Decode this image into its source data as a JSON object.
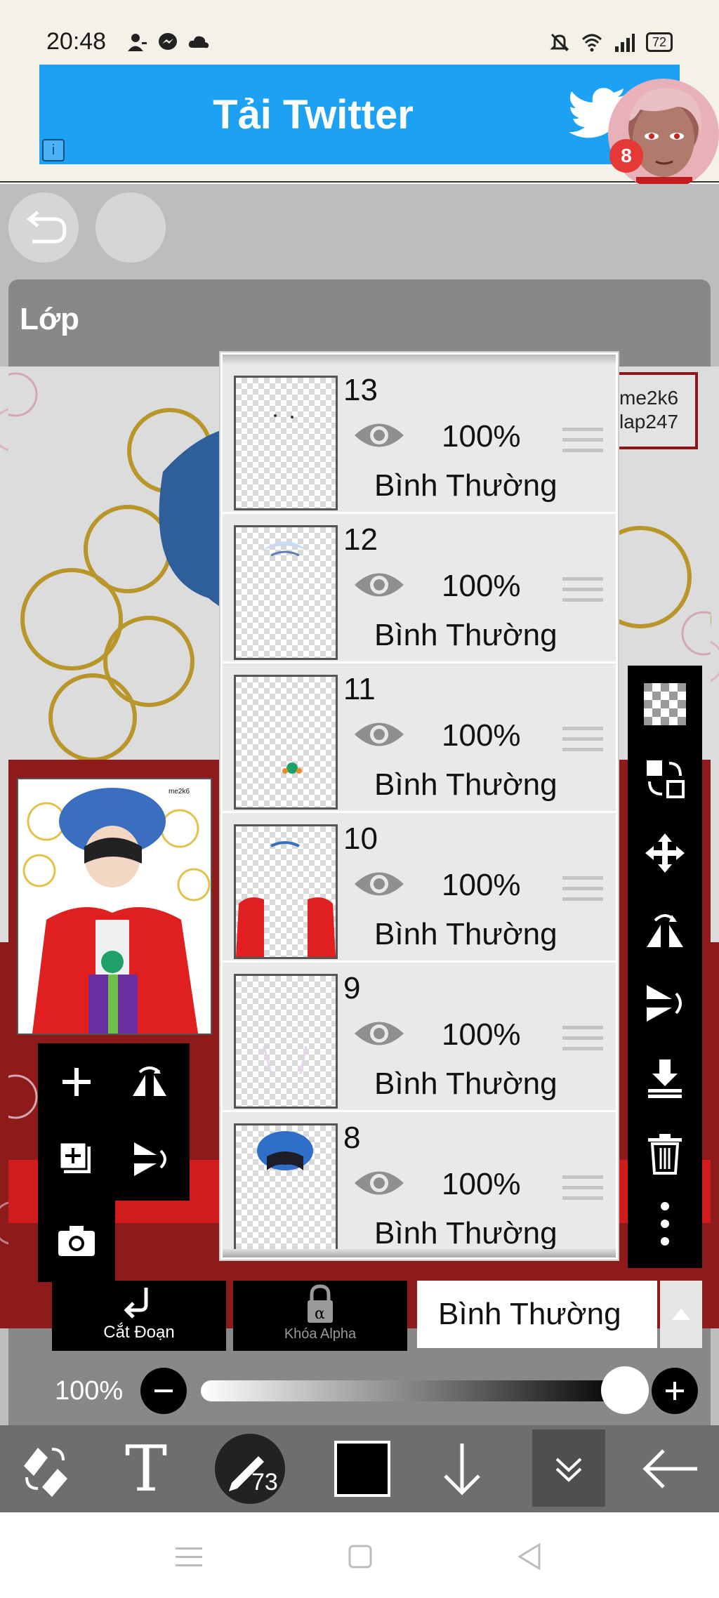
{
  "status_bar": {
    "time": "20:48",
    "battery": "72",
    "left_icons": [
      "person-icon",
      "messenger-icon",
      "cloud-icon"
    ],
    "right_icons": [
      "mute-icon",
      "wifi-icon",
      "signal-icon",
      "battery-icon"
    ]
  },
  "ad": {
    "text": "Tải Twitter",
    "info_label": "i",
    "badge_count": "8",
    "color": "#1da1f2"
  },
  "panel": {
    "title": "Lớp"
  },
  "canvas": {
    "watermark_line1": "me2k6",
    "watermark_line2": "lap247"
  },
  "layers": [
    {
      "number": "13",
      "opacity": "100%",
      "blend": "Bình Thường"
    },
    {
      "number": "12",
      "opacity": "100%",
      "blend": "Bình Thường"
    },
    {
      "number": "11",
      "opacity": "100%",
      "blend": "Bình Thường"
    },
    {
      "number": "10",
      "opacity": "100%",
      "blend": "Bình Thường"
    },
    {
      "number": "9",
      "opacity": "100%",
      "blend": "Bình Thường"
    },
    {
      "number": "8",
      "opacity": "100%",
      "blend": "Bình Thường"
    }
  ],
  "controls": {
    "clip_label": "Cắt Đoạn",
    "alpha_lock_label": "Khóa Alpha",
    "blend_mode": "Bình Thường",
    "opacity_label": "100%",
    "opacity_value": 1.0
  },
  "toolbar": {
    "brush_size": "73",
    "text_tool_glyph": "T",
    "current_color": "#000000"
  },
  "colors": {
    "panel_bg": "#888888",
    "toolbar_bg": "#6e6e6e",
    "accent_red": "#e02020"
  }
}
